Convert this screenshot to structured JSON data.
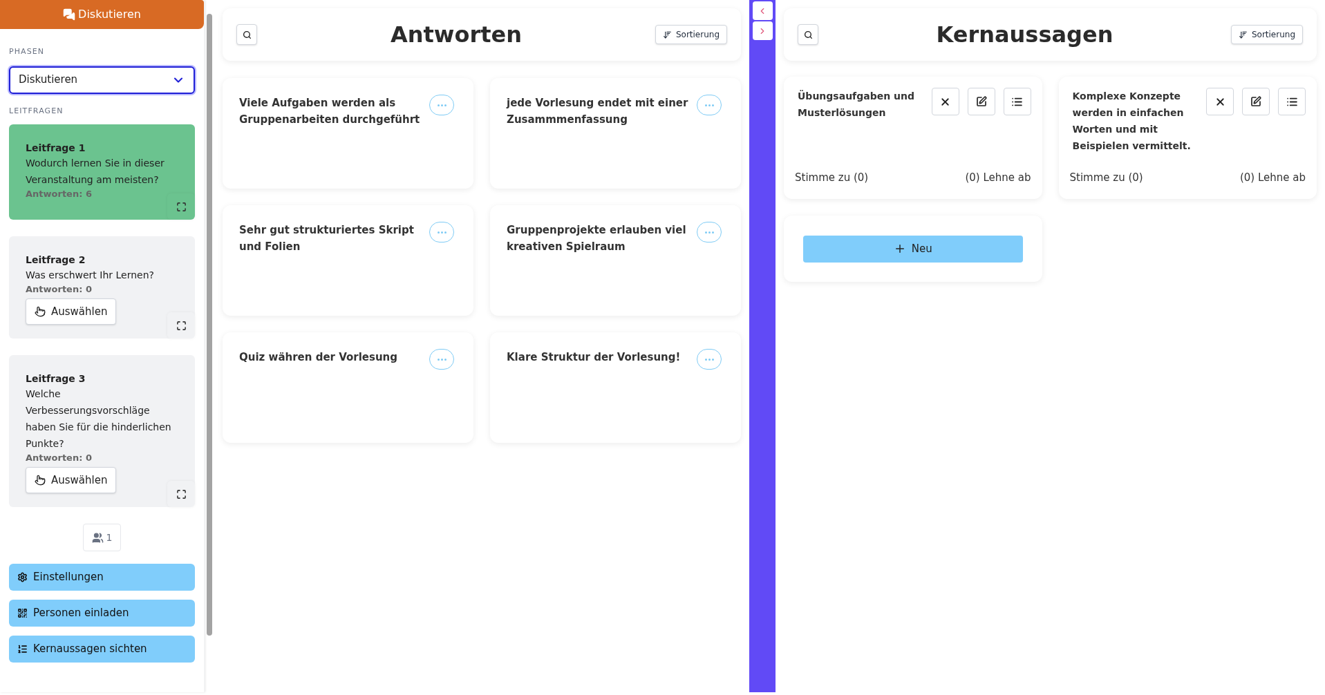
{
  "header": {
    "label": "Diskutieren"
  },
  "phases": {
    "label": "PHASEN",
    "value": "Diskutieren"
  },
  "questions_label": "LEITFRAGEN",
  "questions": [
    {
      "title": "Leitfrage 1",
      "text": "Wodurch lernen Sie in dieser Veranstaltung am meisten?",
      "count": "Antworten: 6",
      "selected": true
    },
    {
      "title": "Leitfrage 2",
      "text": "Was erschwert Ihr Lernen?",
      "count": "Antworten: 0",
      "button": "Auswählen",
      "selected": false
    },
    {
      "title": "Leitfrage 3",
      "text": "Welche Verbesserungsvorschläge haben Sie für die hinderlichen Punkte?",
      "count": "Antworten: 0",
      "button": "Auswählen",
      "selected": false
    }
  ],
  "participants": "1",
  "actions": [
    {
      "label": "Einstellungen",
      "kind": "settings"
    },
    {
      "label": "Personen einladen",
      "kind": "invite"
    },
    {
      "label": "Kernaussagen sichten",
      "kind": "list"
    }
  ],
  "answers": {
    "title": "Antworten",
    "sort": "Sortierung",
    "cards": [
      {
        "text": "Viele Aufgaben werden als Gruppenarbeiten durchgeführt"
      },
      {
        "text": "jede Vorlesung endet mit einer Zusammmenfassung"
      },
      {
        "text": "Sehr gut strukturiertes Skript und Folien"
      },
      {
        "text": "Gruppenprojekte erlauben viel kreativen Spielraum"
      },
      {
        "text": "Quiz währen der Vorlesung"
      },
      {
        "text": "Klare Struktur der Vorlesung!"
      }
    ]
  },
  "statements": {
    "title": "Kernaussagen",
    "sort": "Sortierung",
    "cards": [
      {
        "text": "Übungsaufgaben und Musterlösungen",
        "agree": "Stimme zu (0)",
        "reject": "(0) Lehne ab"
      },
      {
        "text": "Komplexe Konzepte werden in einfachen Worten und mit Beispielen vermittelt.",
        "agree": "Stimme zu (0)",
        "reject": "(0) Lehne ab"
      }
    ],
    "new_button": "Neu"
  }
}
